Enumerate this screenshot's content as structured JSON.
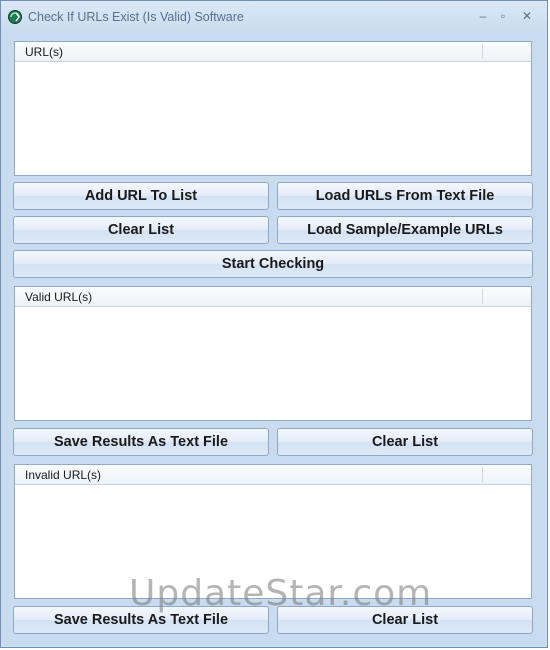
{
  "window": {
    "title": "Check If URLs Exist (Is Valid) Software",
    "controls": {
      "minimize": "–",
      "maximize": "▫",
      "close": "✕"
    }
  },
  "urls_list": {
    "header": "URL(s)",
    "items": []
  },
  "actions": {
    "add_url": "Add URL To List",
    "load_from_file": "Load URLs From Text File",
    "clear_list": "Clear List",
    "load_sample": "Load Sample/Example URLs",
    "start_checking": "Start Checking"
  },
  "valid_list": {
    "header": "Valid URL(s)",
    "items": [],
    "save_label": "Save Results As Text File",
    "clear_label": "Clear List"
  },
  "invalid_list": {
    "header": "Invalid URL(s)",
    "items": [],
    "save_label": "Save Results As Text File",
    "clear_label": "Clear List"
  },
  "watermark": "UpdateStar.com",
  "colors": {
    "window_bg": "#c8dbef",
    "button_border": "#8ea7c6",
    "title_text": "#59708c"
  }
}
